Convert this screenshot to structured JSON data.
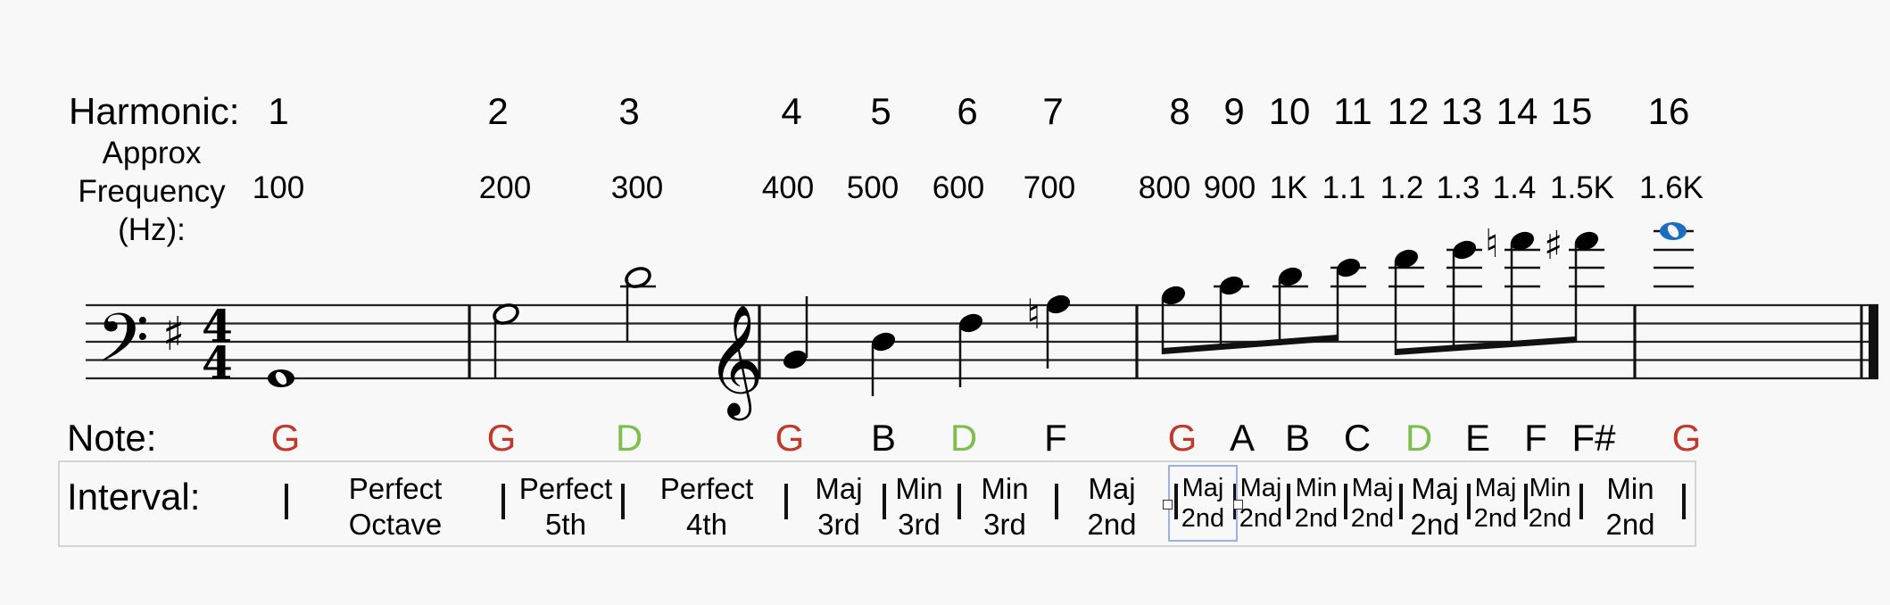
{
  "header": {
    "harmonic_label": "Harmonic:",
    "frequency_label_lines": [
      "Approx",
      "Frequency",
      "(Hz):"
    ]
  },
  "harmonics": [
    {
      "n": "1",
      "freq": "100"
    },
    {
      "n": "2",
      "freq": "200"
    },
    {
      "n": "3",
      "freq": "300"
    },
    {
      "n": "4",
      "freq": "400"
    },
    {
      "n": "5",
      "freq": "500"
    },
    {
      "n": "6",
      "freq": "600"
    },
    {
      "n": "7",
      "freq": "700"
    },
    {
      "n": "8",
      "freq": "800"
    },
    {
      "n": "9",
      "freq": "900"
    },
    {
      "n": "10",
      "freq": "1K"
    },
    {
      "n": "11",
      "freq": "1.1"
    },
    {
      "n": "12",
      "freq": "1.2"
    },
    {
      "n": "13",
      "freq": "1.3"
    },
    {
      "n": "14",
      "freq": "1.4"
    },
    {
      "n": "15",
      "freq": "1.5K"
    },
    {
      "n": "16",
      "freq": "1.6K"
    }
  ],
  "score": {
    "clef_start": "bass",
    "key_signature": "1 sharp (G major)",
    "time_signature": {
      "top": "4",
      "bottom": "4"
    },
    "clef_change": "treble",
    "glyphs": {
      "bass_clef": "𝄢",
      "treble_clef": "𝄞",
      "sharp": "♯",
      "natural": "♮"
    },
    "highlight_color": "#1a6ec2"
  },
  "notes_row": {
    "label": "Note:",
    "colors": {
      "root": "#c0392b",
      "fifth": "#7dbf4e",
      "other": "#000000"
    },
    "notes": [
      {
        "name": "G",
        "role": "root"
      },
      {
        "name": "G",
        "role": "root"
      },
      {
        "name": "D",
        "role": "fifth"
      },
      {
        "name": "G",
        "role": "root"
      },
      {
        "name": "B",
        "role": "other"
      },
      {
        "name": "D",
        "role": "fifth"
      },
      {
        "name": "F",
        "role": "other"
      },
      {
        "name": "G",
        "role": "root"
      },
      {
        "name": "A",
        "role": "other"
      },
      {
        "name": "B",
        "role": "other"
      },
      {
        "name": "C",
        "role": "other"
      },
      {
        "name": "D",
        "role": "fifth"
      },
      {
        "name": "E",
        "role": "other"
      },
      {
        "name": "F",
        "role": "other"
      },
      {
        "name": "F#",
        "role": "other"
      },
      {
        "name": "G",
        "role": "root"
      }
    ]
  },
  "interval_row": {
    "label": "Interval:",
    "separator": "|",
    "intervals": [
      [
        "Perfect",
        "Octave"
      ],
      [
        "Perfect",
        "5th"
      ],
      [
        "Perfect",
        "4th"
      ],
      [
        "Maj",
        "3rd"
      ],
      [
        "Min",
        "3rd"
      ],
      [
        "Min",
        "3rd"
      ],
      [
        "Maj",
        "2nd"
      ],
      [
        "Maj",
        "2nd"
      ],
      [
        "Maj",
        "2nd"
      ],
      [
        "Min",
        "2nd"
      ],
      [
        "Maj",
        "2nd"
      ],
      [
        "Maj",
        "2nd"
      ],
      [
        "Maj",
        "2nd"
      ],
      [
        "Min",
        "2nd"
      ],
      [
        "Min",
        "2nd"
      ]
    ],
    "selected_index": 7
  }
}
